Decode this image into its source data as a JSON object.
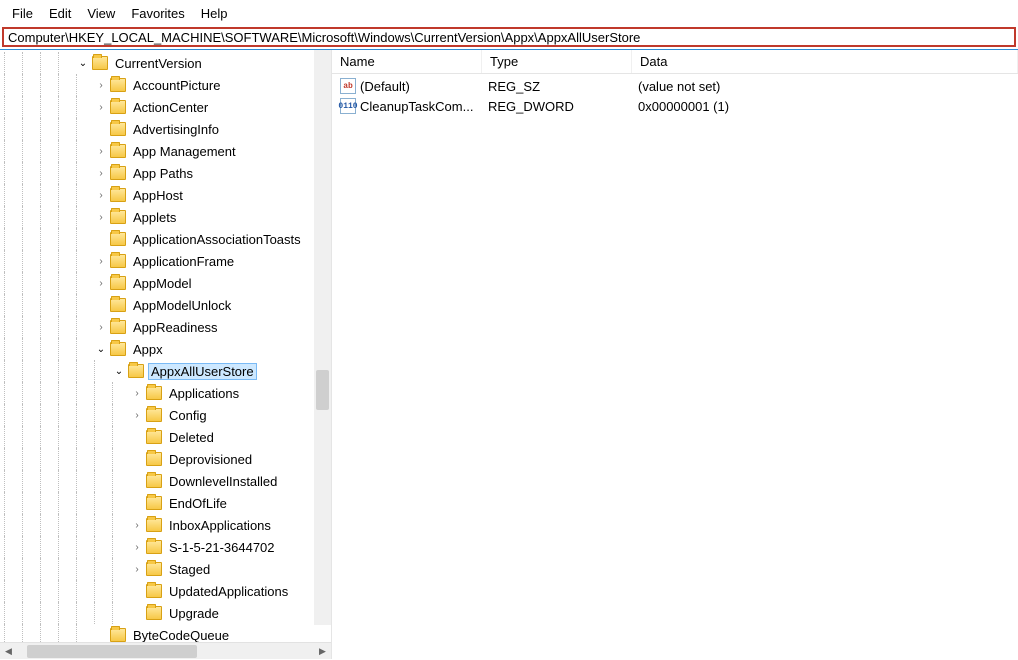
{
  "menu": {
    "file": "File",
    "edit": "Edit",
    "view": "View",
    "favorites": "Favorites",
    "help": "Help"
  },
  "address": "Computer\\HKEY_LOCAL_MACHINE\\SOFTWARE\\Microsoft\\Windows\\CurrentVersion\\Appx\\AppxAllUserStore",
  "columns": {
    "name": "Name",
    "type": "Type",
    "data": "Data"
  },
  "values": [
    {
      "icon": "ab",
      "name": "(Default)",
      "type": "REG_SZ",
      "data": "(value not set)"
    },
    {
      "icon": "nn",
      "name": "CleanupTaskCom...",
      "type": "REG_DWORD",
      "data": "0x00000001 (1)"
    }
  ],
  "tree": {
    "n0": "CurrentVersion",
    "n1": "AccountPicture",
    "n2": "ActionCenter",
    "n3": "AdvertisingInfo",
    "n4": "App Management",
    "n5": "App Paths",
    "n6": "AppHost",
    "n7": "Applets",
    "n8": "ApplicationAssociationToasts",
    "n9": "ApplicationFrame",
    "n10": "AppModel",
    "n11": "AppModelUnlock",
    "n12": "AppReadiness",
    "n13": "Appx",
    "n14": "AppxAllUserStore",
    "n15": "Applications",
    "n16": "Config",
    "n17": "Deleted",
    "n18": "Deprovisioned",
    "n19": "DownlevelInstalled",
    "n20": "EndOfLife",
    "n21": "InboxApplications",
    "n22": "S-1-5-21-3644702",
    "n23": "Staged",
    "n24": "UpdatedApplications",
    "n25": "Upgrade",
    "n26": "ByteCodeQueue"
  }
}
